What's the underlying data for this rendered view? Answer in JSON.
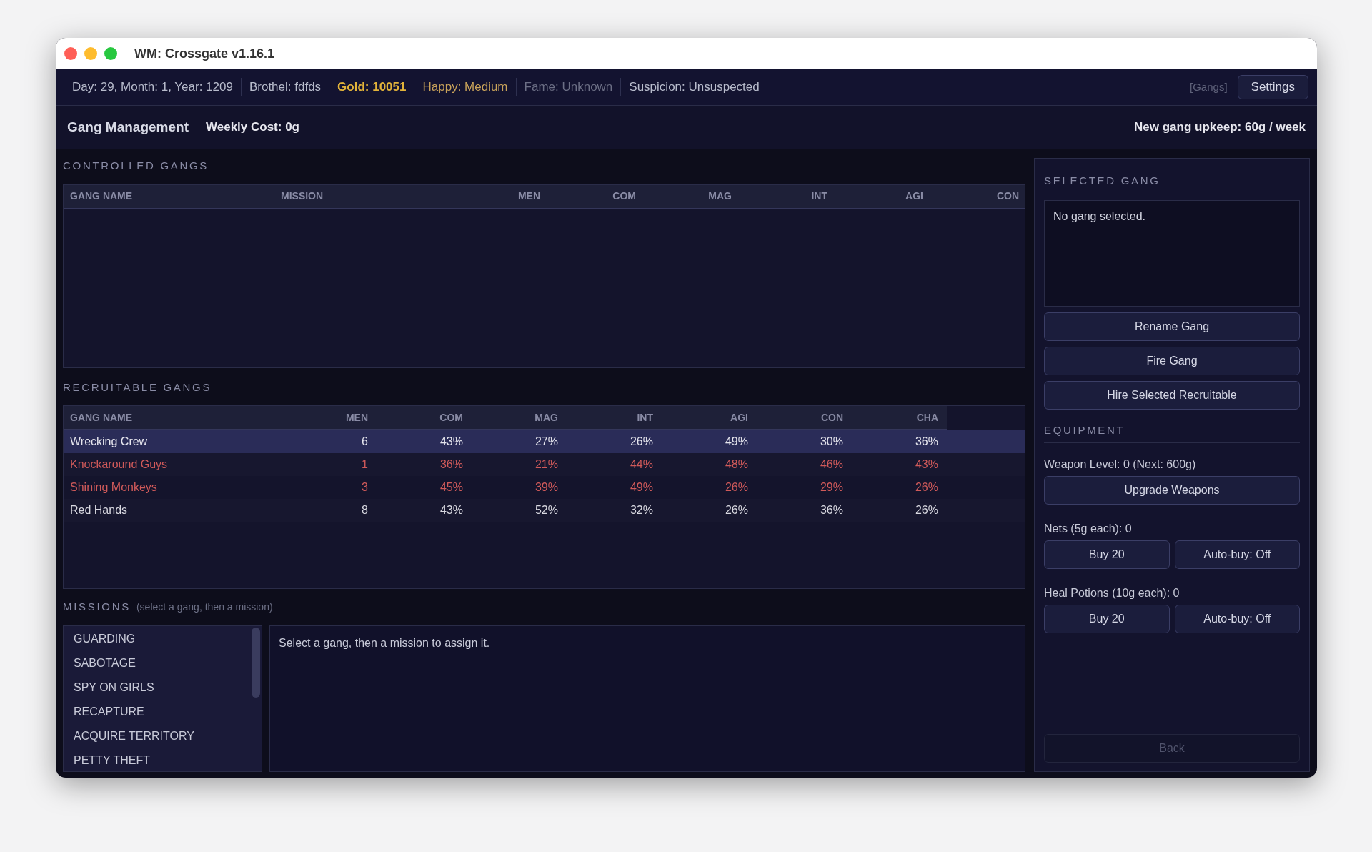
{
  "window": {
    "title": "WM: Crossgate v1.16.1"
  },
  "status_bar": {
    "items": [
      {
        "text": "Day: 29, Month: 1, Year: 1209",
        "kind": "normal"
      },
      {
        "text": "Brothel: fdfds",
        "kind": "normal"
      },
      {
        "text": "Gold: 10051",
        "kind": "gold"
      },
      {
        "text": "Happy: Medium",
        "kind": "happy"
      },
      {
        "text": "Fame: Unknown",
        "kind": "dim"
      },
      {
        "text": "Suspicion: Unsuspected",
        "kind": "normal"
      }
    ],
    "screen_tag": "[Gangs]",
    "settings_button": "Settings"
  },
  "header": {
    "title": "Gang Management",
    "weekly_cost": "Weekly Cost: 0g",
    "upkeep": "New gang upkeep: 60g / week"
  },
  "controlled_gangs": {
    "title": "CONTROLLED GANGS",
    "columns": [
      "GANG NAME",
      "MISSION",
      "MEN",
      "COM",
      "MAG",
      "INT",
      "AGI",
      "CON"
    ]
  },
  "recruitable_gangs": {
    "title": "RECRUITABLE GANGS",
    "columns": [
      "GANG NAME",
      "MEN",
      "COM",
      "MAG",
      "INT",
      "AGI",
      "CON",
      "CHA"
    ],
    "rows": [
      {
        "cells": [
          "Wrecking Crew",
          "6",
          "43%",
          "27%",
          "26%",
          "49%",
          "30%",
          "36%"
        ],
        "selected": true,
        "color": "#e6e6ee"
      },
      {
        "cells": [
          "Knockaround Guys",
          "1",
          "36%",
          "21%",
          "44%",
          "48%",
          "46%",
          "43%"
        ],
        "selected": false,
        "color": "#d05a5a"
      },
      {
        "cells": [
          "Shining Monkeys",
          "3",
          "45%",
          "39%",
          "49%",
          "26%",
          "29%",
          "26%"
        ],
        "selected": false,
        "color": "#d05a5a"
      },
      {
        "cells": [
          "Red Hands",
          "8",
          "43%",
          "52%",
          "32%",
          "26%",
          "36%",
          "26%"
        ],
        "selected": false,
        "color": "#d8d8e0"
      }
    ]
  },
  "missions": {
    "title": "MISSIONS",
    "hint": "(select a gang, then a mission)",
    "items": [
      "GUARDING",
      "SABOTAGE",
      "SPY ON GIRLS",
      "RECAPTURE",
      "ACQUIRE TERRITORY",
      "PETTY THEFT"
    ],
    "description": "Select a gang, then a mission to assign it."
  },
  "selected_gang": {
    "title": "SELECTED GANG",
    "info": "No gang selected.",
    "buttons": [
      "Rename Gang",
      "Fire Gang",
      "Hire Selected Recruitable"
    ]
  },
  "equipment": {
    "title": "EQUIPMENT",
    "weapon_label": "Weapon Level: 0 (Next: 600g)",
    "upgrade_button": "Upgrade Weapons",
    "supplies": [
      {
        "label": "Nets (5g each): 0",
        "buy": "Buy 20",
        "auto": "Auto-buy: Off"
      },
      {
        "label": "Heal Potions (10g each): 0",
        "buy": "Buy 20",
        "auto": "Auto-buy: Off"
      }
    ]
  },
  "back_button": {
    "label": "Back",
    "disabled": true
  }
}
